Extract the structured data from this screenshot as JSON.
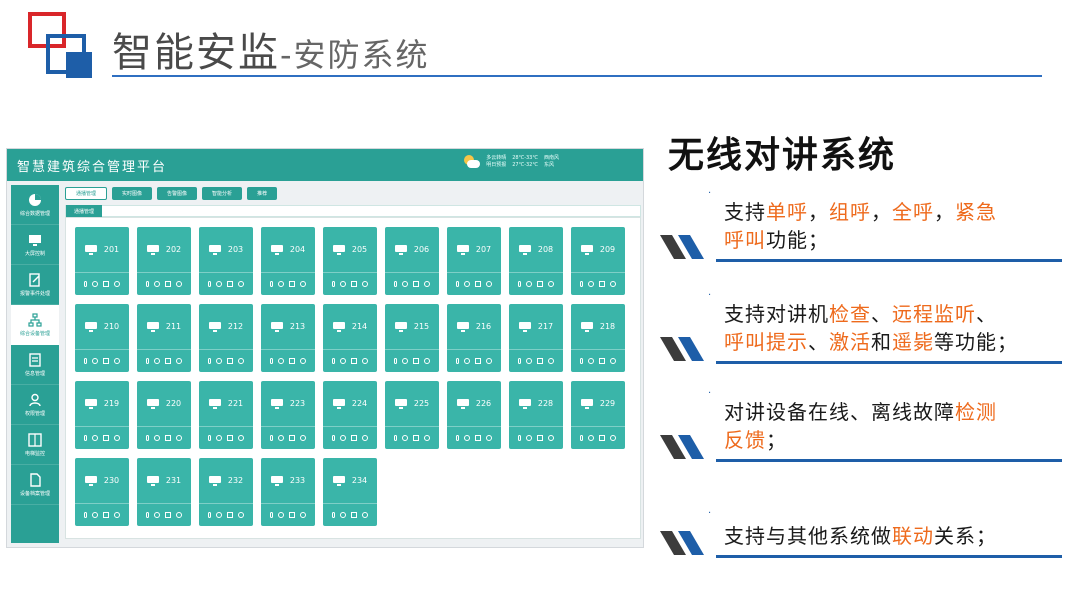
{
  "slide": {
    "title_main": "智能安监",
    "title_sub": "-安防系统"
  },
  "app": {
    "name": "智慧建筑综合管理平台",
    "weather": {
      "condition": "多云转晴",
      "temp": "28℃-33℃",
      "wind": "西南风",
      "line2_a": "明日预报",
      "line2_b": "27℃-32℃",
      "line2_c": "东风"
    },
    "sidebar": [
      {
        "label": "综合数据管理",
        "icon": "pie-chart-icon"
      },
      {
        "label": "大屏控制",
        "icon": "monitor-icon"
      },
      {
        "label": "报警事件处理",
        "icon": "edit-doc-icon"
      },
      {
        "label": "综合设备管理",
        "icon": "network-icon",
        "active": true
      },
      {
        "label": "信息管理",
        "icon": "document-icon"
      },
      {
        "label": "权限管理",
        "icon": "user-icon"
      },
      {
        "label": "电梯监控",
        "icon": "elevator-icon"
      },
      {
        "label": "设备档案管理",
        "icon": "file-icon"
      }
    ],
    "toolbar": [
      "通播管理",
      "实时图像",
      "告警图像",
      "智能分析",
      "推荐"
    ],
    "tab": "通播管理",
    "devices": [
      "201",
      "202",
      "203",
      "204",
      "205",
      "206",
      "207",
      "208",
      "209",
      "210",
      "211",
      "212",
      "213",
      "214",
      "215",
      "216",
      "217",
      "218",
      "219",
      "220",
      "221",
      "223",
      "224",
      "225",
      "226",
      "228",
      "229",
      "230",
      "231",
      "232",
      "233",
      "234"
    ]
  },
  "right": {
    "heading": "无线对讲系统",
    "features": [
      {
        "line1": [
          [
            "支持",
            ""
          ],
          [
            "单呼",
            "hl"
          ],
          [
            "，",
            ""
          ],
          [
            "组呼",
            "hl"
          ],
          [
            "，",
            ""
          ],
          [
            "全呼",
            "hl"
          ],
          [
            "，",
            ""
          ],
          [
            "紧急",
            "hl"
          ]
        ],
        "line2": [
          [
            "呼叫",
            "hl"
          ],
          [
            "功能；",
            ""
          ]
        ]
      },
      {
        "line1": [
          [
            "支持对讲机",
            ""
          ],
          [
            "检查",
            "hl"
          ],
          [
            "、",
            ""
          ],
          [
            "远程监听",
            "hl"
          ],
          [
            "、",
            ""
          ]
        ],
        "line2": [
          [
            "呼叫提示",
            "hl"
          ],
          [
            "、",
            ""
          ],
          [
            "激活",
            "hl"
          ],
          [
            "和",
            ""
          ],
          [
            "遥毙",
            "hl"
          ],
          [
            "等功能；",
            ""
          ]
        ]
      },
      {
        "line1": [
          [
            "对讲设备在线、离线故障",
            ""
          ],
          [
            "检测",
            "hl"
          ]
        ],
        "line2": [
          [
            "反馈",
            "hl"
          ],
          [
            "；",
            ""
          ]
        ]
      },
      {
        "line1": [
          [
            "支持与其他系统做",
            ""
          ],
          [
            "联动",
            "hl"
          ],
          [
            "关系；",
            ""
          ]
        ],
        "line2": []
      }
    ],
    "colors": {
      "accent": "#ee6a1c",
      "brand_blue": "#1e5ea8",
      "teal": "#2aa095"
    }
  }
}
